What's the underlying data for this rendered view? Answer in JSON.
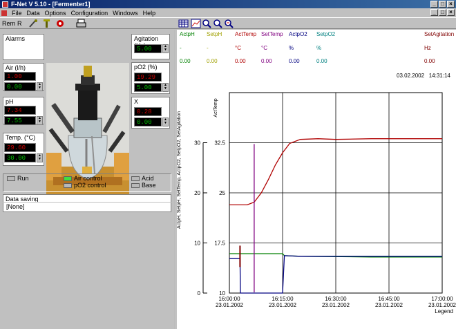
{
  "window": {
    "title": "F-Net V 5.10 - [Fermenter1]"
  },
  "menu": [
    "File",
    "Data",
    "Options",
    "Configuration",
    "Windows",
    "Help"
  ],
  "toolbar": {
    "rem": "Rem",
    "r": "R"
  },
  "alarms": {
    "label": "Alarms"
  },
  "air": {
    "label": "Air (l/h)",
    "actual": "1.00",
    "setpoint": "0.00"
  },
  "ph": {
    "label": "pH",
    "actual": "7.34",
    "setpoint": "7.55"
  },
  "temp": {
    "label": "Temp. (°C)",
    "actual": "29.60",
    "setpoint": "30.00"
  },
  "agitation": {
    "label": "Agitation (Hz)",
    "setpoint": "5.00"
  },
  "po2": {
    "label": "pO2 (%)",
    "actual": "19.29",
    "setpoint": "5.00"
  },
  "x": {
    "label": "X",
    "actual": "0.28",
    "setpoint": "0.00"
  },
  "controls": {
    "run": "Run",
    "air_control": "Air control",
    "po2_control": "pO2 control",
    "acid": "Acid",
    "base": "Base"
  },
  "data_saving": {
    "label": "Data saving",
    "value": "[None]"
  },
  "colors": {
    "actph": "#008000",
    "setph": "#a0a000",
    "acttemp": "#b00000",
    "settemp": "#800080",
    "actpo2": "#000080",
    "setpo2": "#008080",
    "setagitation": "#800000"
  },
  "header": {
    "columns": [
      {
        "name": "ActpH",
        "unit": "-",
        "value": "0.00"
      },
      {
        "name": "SetpH",
        "unit": "-",
        "value": "0.00"
      },
      {
        "name": "ActTemp",
        "unit": "°C",
        "value": "0.00"
      },
      {
        "name": "SetTemp",
        "unit": "°C",
        "value": "0.00"
      },
      {
        "name": "ActpO2",
        "unit": "%",
        "value": "0.00"
      },
      {
        "name": "SetpO2",
        "unit": "%",
        "value": "0.00"
      }
    ],
    "setagitation": {
      "name": "SetAgitation",
      "unit": "Hz",
      "value": "0.00"
    },
    "timestamp": "03.02.2002   14:31:14"
  },
  "chart_data": {
    "type": "line",
    "ylabel_outer": "ActpH, SetpH, SetTemp, ActpO2, SetpO2, SetAgitation",
    "ylabel_inner": "ActTemp",
    "outer_ticks": [
      "0",
      "10",
      "20",
      "30"
    ],
    "inner_ticks": [
      "10",
      "17.5",
      "25",
      "32.5"
    ],
    "x_ticks": [
      {
        "time": "16:00:00",
        "date": "23.01.2002"
      },
      {
        "time": "16:15:00",
        "date": "23.01.2002"
      },
      {
        "time": "16:30:00",
        "date": "23.01.2002"
      },
      {
        "time": "16:45:00",
        "date": "23.01.2002"
      },
      {
        "time": "17:00:00",
        "date": "23.01.2002"
      }
    ],
    "xlim_minutes": [
      0,
      60
    ],
    "inner_ylim": [
      10,
      40
    ],
    "legend_label": "Legend",
    "series": [
      {
        "name": "ActTemp",
        "axis": "inner",
        "x": [
          0,
          5,
          7,
          9,
          11,
          13,
          15,
          17,
          20,
          25,
          30,
          40,
          50,
          60
        ],
        "y": [
          23.2,
          23.2,
          23.6,
          25.0,
          27.0,
          29.2,
          31.0,
          32.4,
          33.0,
          33.1,
          33.0,
          33.1,
          33.1,
          33.1
        ]
      },
      {
        "name": "ActpH",
        "axis": "inner",
        "x": [
          0,
          15,
          15.5,
          20,
          40,
          60
        ],
        "y": [
          15.9,
          15.9,
          15.6,
          15.5,
          15.4,
          15.4
        ]
      },
      {
        "name": "ActpO2",
        "axis": "inner",
        "x": [
          0,
          3,
          3.1,
          15,
          15.5,
          20,
          40,
          60
        ],
        "y": [
          15.2,
          15.2,
          10.0,
          10.0,
          15.6,
          15.5,
          15.5,
          15.5
        ]
      },
      {
        "name": "SetTemp",
        "axis": "inner",
        "x": [
          7,
          7
        ],
        "y": [
          10.1,
          32.3
        ]
      },
      {
        "name": "SetAgitation",
        "axis": "inner",
        "x": [
          3,
          3
        ],
        "y": [
          17.1,
          13.9
        ]
      }
    ]
  }
}
